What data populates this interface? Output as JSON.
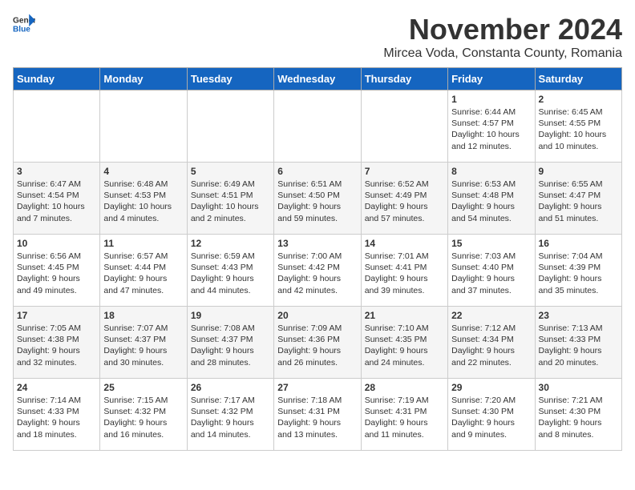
{
  "header": {
    "logo_general": "General",
    "logo_blue": "Blue",
    "month_title": "November 2024",
    "subtitle": "Mircea Voda, Constanta County, Romania"
  },
  "weekdays": [
    "Sunday",
    "Monday",
    "Tuesday",
    "Wednesday",
    "Thursday",
    "Friday",
    "Saturday"
  ],
  "weeks": [
    [
      {
        "day": "",
        "info": ""
      },
      {
        "day": "",
        "info": ""
      },
      {
        "day": "",
        "info": ""
      },
      {
        "day": "",
        "info": ""
      },
      {
        "day": "",
        "info": ""
      },
      {
        "day": "1",
        "info": "Sunrise: 6:44 AM\nSunset: 4:57 PM\nDaylight: 10 hours\nand 12 minutes."
      },
      {
        "day": "2",
        "info": "Sunrise: 6:45 AM\nSunset: 4:55 PM\nDaylight: 10 hours\nand 10 minutes."
      }
    ],
    [
      {
        "day": "3",
        "info": "Sunrise: 6:47 AM\nSunset: 4:54 PM\nDaylight: 10 hours\nand 7 minutes."
      },
      {
        "day": "4",
        "info": "Sunrise: 6:48 AM\nSunset: 4:53 PM\nDaylight: 10 hours\nand 4 minutes."
      },
      {
        "day": "5",
        "info": "Sunrise: 6:49 AM\nSunset: 4:51 PM\nDaylight: 10 hours\nand 2 minutes."
      },
      {
        "day": "6",
        "info": "Sunrise: 6:51 AM\nSunset: 4:50 PM\nDaylight: 9 hours\nand 59 minutes."
      },
      {
        "day": "7",
        "info": "Sunrise: 6:52 AM\nSunset: 4:49 PM\nDaylight: 9 hours\nand 57 minutes."
      },
      {
        "day": "8",
        "info": "Sunrise: 6:53 AM\nSunset: 4:48 PM\nDaylight: 9 hours\nand 54 minutes."
      },
      {
        "day": "9",
        "info": "Sunrise: 6:55 AM\nSunset: 4:47 PM\nDaylight: 9 hours\nand 51 minutes."
      }
    ],
    [
      {
        "day": "10",
        "info": "Sunrise: 6:56 AM\nSunset: 4:45 PM\nDaylight: 9 hours\nand 49 minutes."
      },
      {
        "day": "11",
        "info": "Sunrise: 6:57 AM\nSunset: 4:44 PM\nDaylight: 9 hours\nand 47 minutes."
      },
      {
        "day": "12",
        "info": "Sunrise: 6:59 AM\nSunset: 4:43 PM\nDaylight: 9 hours\nand 44 minutes."
      },
      {
        "day": "13",
        "info": "Sunrise: 7:00 AM\nSunset: 4:42 PM\nDaylight: 9 hours\nand 42 minutes."
      },
      {
        "day": "14",
        "info": "Sunrise: 7:01 AM\nSunset: 4:41 PM\nDaylight: 9 hours\nand 39 minutes."
      },
      {
        "day": "15",
        "info": "Sunrise: 7:03 AM\nSunset: 4:40 PM\nDaylight: 9 hours\nand 37 minutes."
      },
      {
        "day": "16",
        "info": "Sunrise: 7:04 AM\nSunset: 4:39 PM\nDaylight: 9 hours\nand 35 minutes."
      }
    ],
    [
      {
        "day": "17",
        "info": "Sunrise: 7:05 AM\nSunset: 4:38 PM\nDaylight: 9 hours\nand 32 minutes."
      },
      {
        "day": "18",
        "info": "Sunrise: 7:07 AM\nSunset: 4:37 PM\nDaylight: 9 hours\nand 30 minutes."
      },
      {
        "day": "19",
        "info": "Sunrise: 7:08 AM\nSunset: 4:37 PM\nDaylight: 9 hours\nand 28 minutes."
      },
      {
        "day": "20",
        "info": "Sunrise: 7:09 AM\nSunset: 4:36 PM\nDaylight: 9 hours\nand 26 minutes."
      },
      {
        "day": "21",
        "info": "Sunrise: 7:10 AM\nSunset: 4:35 PM\nDaylight: 9 hours\nand 24 minutes."
      },
      {
        "day": "22",
        "info": "Sunrise: 7:12 AM\nSunset: 4:34 PM\nDaylight: 9 hours\nand 22 minutes."
      },
      {
        "day": "23",
        "info": "Sunrise: 7:13 AM\nSunset: 4:33 PM\nDaylight: 9 hours\nand 20 minutes."
      }
    ],
    [
      {
        "day": "24",
        "info": "Sunrise: 7:14 AM\nSunset: 4:33 PM\nDaylight: 9 hours\nand 18 minutes."
      },
      {
        "day": "25",
        "info": "Sunrise: 7:15 AM\nSunset: 4:32 PM\nDaylight: 9 hours\nand 16 minutes."
      },
      {
        "day": "26",
        "info": "Sunrise: 7:17 AM\nSunset: 4:32 PM\nDaylight: 9 hours\nand 14 minutes."
      },
      {
        "day": "27",
        "info": "Sunrise: 7:18 AM\nSunset: 4:31 PM\nDaylight: 9 hours\nand 13 minutes."
      },
      {
        "day": "28",
        "info": "Sunrise: 7:19 AM\nSunset: 4:31 PM\nDaylight: 9 hours\nand 11 minutes."
      },
      {
        "day": "29",
        "info": "Sunrise: 7:20 AM\nSunset: 4:30 PM\nDaylight: 9 hours\nand 9 minutes."
      },
      {
        "day": "30",
        "info": "Sunrise: 7:21 AM\nSunset: 4:30 PM\nDaylight: 9 hours\nand 8 minutes."
      }
    ]
  ]
}
